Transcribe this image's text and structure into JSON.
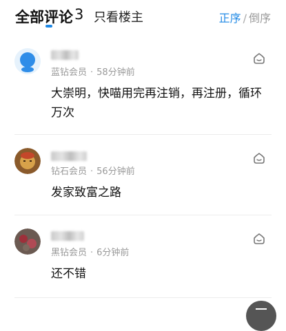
{
  "header": {
    "title": "全部评论",
    "count": "3",
    "filter_label": "只看楼主",
    "sort_asc": "正序",
    "sort_sep": "/",
    "sort_desc": "倒序"
  },
  "comments": [
    {
      "level": "蓝钻会员",
      "time": "58分钟前",
      "text": "大崇明，快喵用完再注销，再注册，循环万次"
    },
    {
      "level": "钻石会员",
      "time": "56分钟前",
      "text": "发家致富之路"
    },
    {
      "level": "黑钻会员",
      "time": "6分钟前",
      "text": "还不错"
    }
  ],
  "meta_sep": "·",
  "colors": {
    "accent": "#1e88e5",
    "meta": "#999999",
    "fab": "#555555"
  },
  "icons": [
    "like-icon",
    "back-to-top-icon"
  ]
}
